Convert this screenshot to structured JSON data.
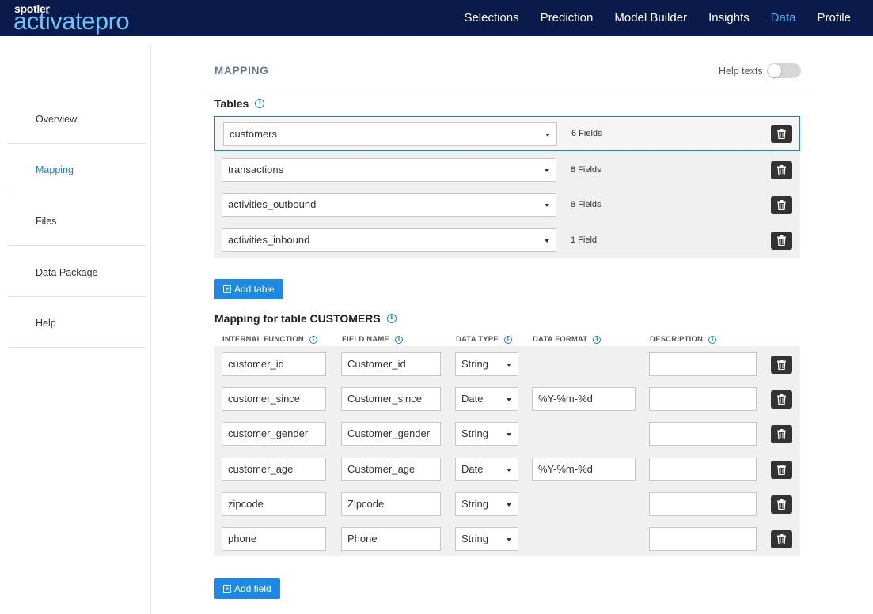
{
  "brand": {
    "small": "spotler",
    "big": "activatepro"
  },
  "nav": [
    {
      "label": "Selections",
      "active": false
    },
    {
      "label": "Prediction",
      "active": false
    },
    {
      "label": "Model Builder",
      "active": false
    },
    {
      "label": "Insights",
      "active": false
    },
    {
      "label": "Data",
      "active": true
    },
    {
      "label": "Profile",
      "active": false
    }
  ],
  "sidebar": [
    {
      "label": "Overview",
      "active": false
    },
    {
      "label": "Mapping",
      "active": true
    },
    {
      "label": "Files",
      "active": false
    },
    {
      "label": "Data Package",
      "active": false
    },
    {
      "label": "Help",
      "active": false
    }
  ],
  "page": {
    "title": "MAPPING",
    "help_label": "Help texts",
    "help_enabled": false
  },
  "tables_section": {
    "title": "Tables",
    "rows": [
      {
        "name": "customers",
        "fields": "6 Fields",
        "selected": true
      },
      {
        "name": "transactions",
        "fields": "8 Fields",
        "selected": false
      },
      {
        "name": "activities_outbound",
        "fields": "8 Fields",
        "selected": false
      },
      {
        "name": "activities_inbound",
        "fields": "1 Field",
        "selected": false
      }
    ],
    "add_label": "Add table"
  },
  "mapping_section": {
    "title": "Mapping for table CUSTOMERS",
    "columns": [
      "INTERNAL FUNCTION",
      "FIELD NAME",
      "DATA TYPE",
      "DATA FORMAT",
      "DESCRIPTION"
    ],
    "rows": [
      {
        "internal": "customer_id",
        "field": "Customer_id",
        "type": "String",
        "format": null,
        "description": ""
      },
      {
        "internal": "customer_since",
        "field": "Customer_since",
        "type": "Date",
        "format": "%Y-%m-%d",
        "description": ""
      },
      {
        "internal": "customer_gender",
        "field": "Customer_gender",
        "type": "String",
        "format": null,
        "description": ""
      },
      {
        "internal": "customer_age",
        "field": "Customer_age",
        "type": "Date",
        "format": "%Y-%m-%d",
        "description": ""
      },
      {
        "internal": "zipcode",
        "field": "Zipcode",
        "type": "String",
        "format": null,
        "description": ""
      },
      {
        "internal": "phone",
        "field": "Phone",
        "type": "String",
        "format": null,
        "description": ""
      }
    ],
    "add_label": "Add field"
  },
  "colors": {
    "header_bg": "#0a1a4a",
    "accent": "#1e88e5",
    "active_nav": "#4aa8f0",
    "logo": "#6cc4ff"
  }
}
